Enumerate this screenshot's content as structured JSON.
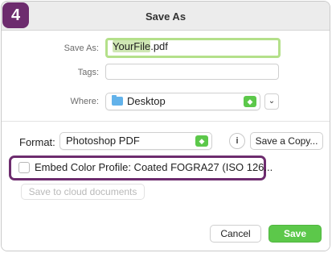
{
  "badge": {
    "number": "4"
  },
  "dialog": {
    "title": "Save As"
  },
  "save_as": {
    "label": "Save As:",
    "filename_selected": "YourFile",
    "filename_ext": ".pdf"
  },
  "tags": {
    "label": "Tags:",
    "value": ""
  },
  "where": {
    "label": "Where:",
    "value": "Desktop"
  },
  "format": {
    "label": "Format:",
    "value": "Photoshop PDF",
    "info_glyph": "i",
    "save_copy_label": "Save a Copy..."
  },
  "embed": {
    "label": "Embed Color Profile:  Coated FOGRA27 (ISO 126..."
  },
  "cloud": {
    "label": "Save to cloud documents"
  },
  "buttons": {
    "cancel": "Cancel",
    "save": "Save"
  },
  "colors": {
    "accent": "#5cc84a",
    "highlight": "#6d2c6e",
    "focus": "#b4e08a"
  }
}
